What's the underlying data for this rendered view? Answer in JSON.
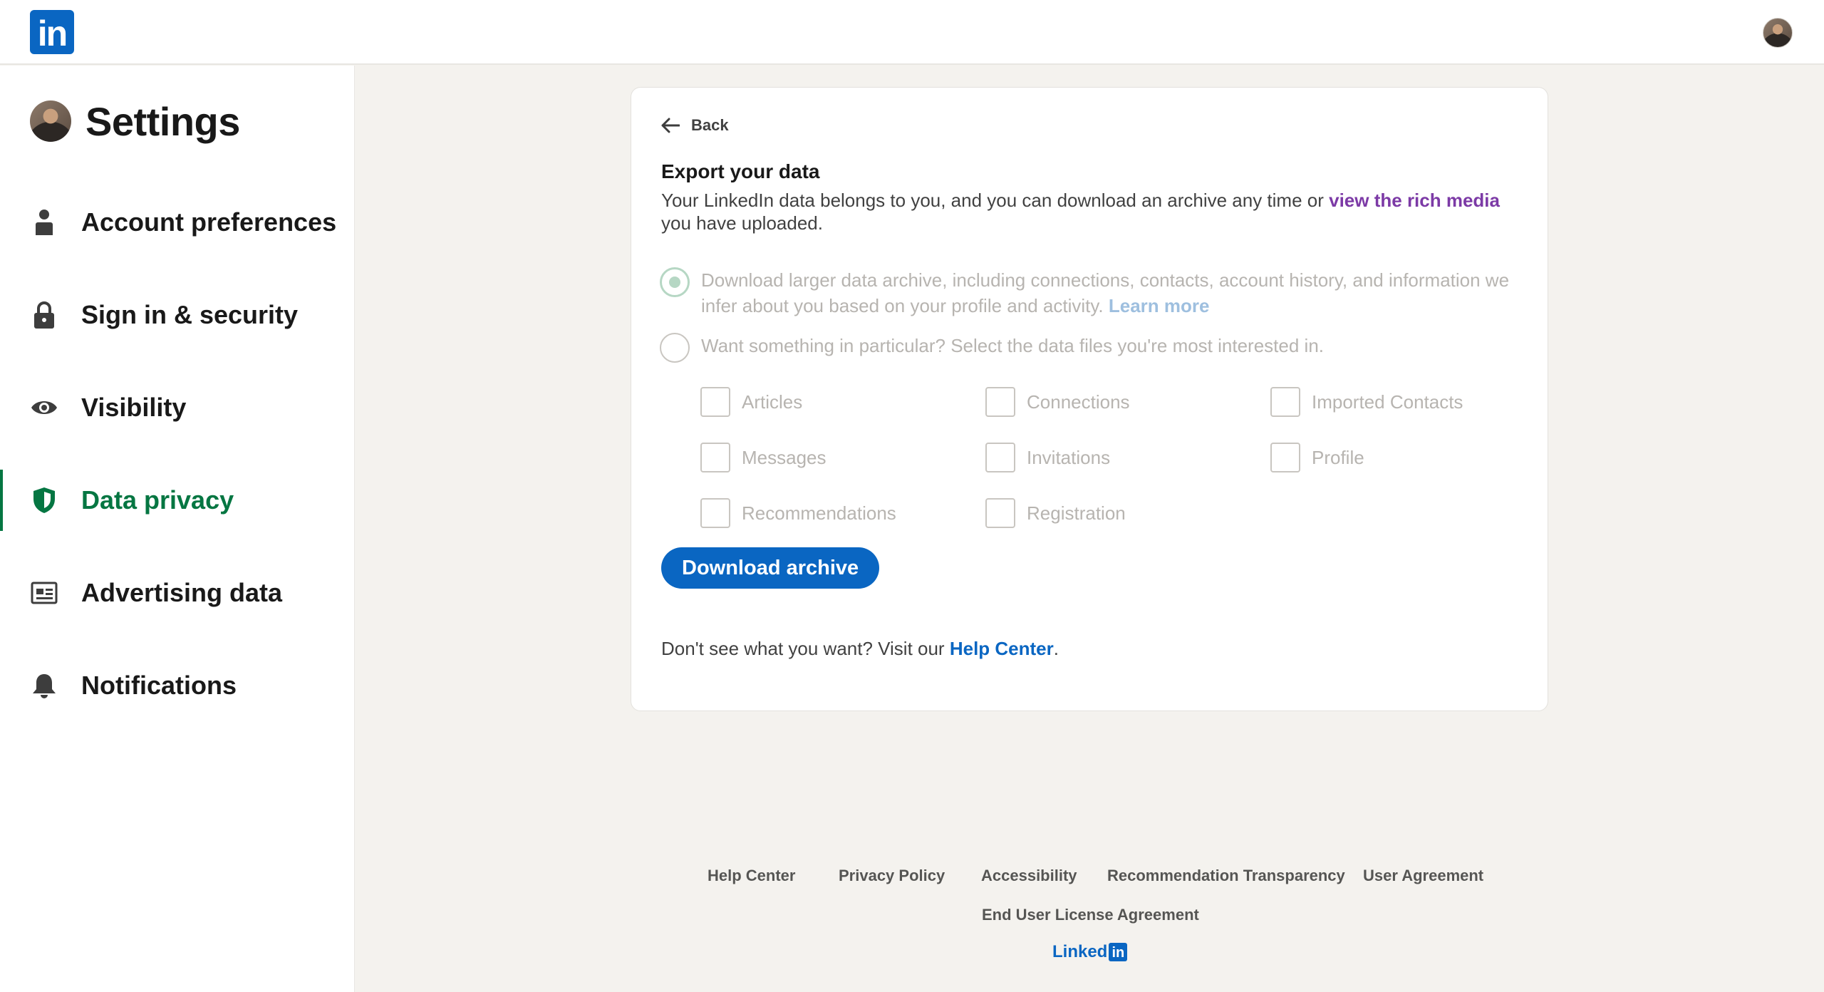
{
  "header": {
    "logo_text": "in"
  },
  "sidebar": {
    "title": "Settings",
    "items": [
      {
        "label": "Account preferences",
        "icon": "person-icon",
        "active": false
      },
      {
        "label": "Sign in & security",
        "icon": "lock-icon",
        "active": false
      },
      {
        "label": "Visibility",
        "icon": "eye-icon",
        "active": false
      },
      {
        "label": "Data privacy",
        "icon": "shield-icon",
        "active": true
      },
      {
        "label": "Advertising data",
        "icon": "newspaper-icon",
        "active": false
      },
      {
        "label": "Notifications",
        "icon": "bell-icon",
        "active": false
      }
    ]
  },
  "card": {
    "back_label": "Back",
    "title": "Export your data",
    "intro_text": "Your LinkedIn data belongs to you, and you can download an archive any time or ",
    "intro_link": "view the rich media",
    "intro_tail": " you have uploaded.",
    "option_larger": {
      "label": "Download larger data archive, including connections, contacts, account history, and information we infer about you based on your profile and activity. ",
      "link": "Learn more",
      "checked": true
    },
    "option_particular": {
      "label": "Want something in particular? Select the data files you're most interested in.",
      "checked": false
    },
    "checkboxes": [
      "Articles",
      "Connections",
      "Imported Contacts",
      "Messages",
      "Invitations",
      "Profile",
      "Recommendations",
      "Registration"
    ],
    "download_button": "Download archive",
    "help_prefix": "Don't see what you want? Visit our ",
    "help_link": "Help Center",
    "help_suffix": "."
  },
  "footer": {
    "links": [
      "Help Center",
      "Privacy Policy",
      "Accessibility",
      "Recommendation Transparency",
      "User Agreement",
      "End User License Agreement"
    ],
    "brand_text": "Linked",
    "brand_box": "in"
  },
  "colors": {
    "brand_blue": "#0a66c2",
    "active_green": "#057642",
    "link_purple": "#7c3aa6",
    "background": "#f4f2ee"
  }
}
